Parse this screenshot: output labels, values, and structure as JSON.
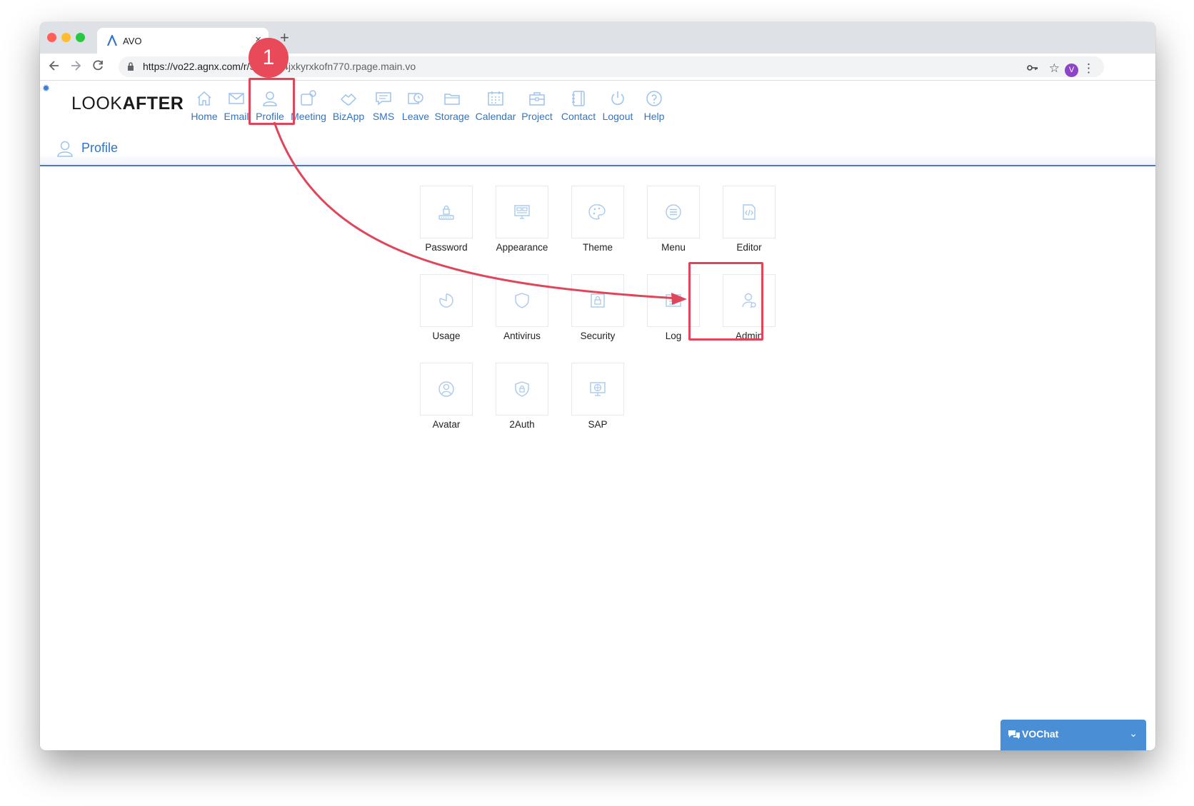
{
  "browser": {
    "tab_title": "AVO",
    "tab_close": "×",
    "new_tab": "+",
    "url_domain": "https://vo22.agnx.com/r/",
    "url_rest": "3976344jxkyrxkofn770.rpage.main.vo",
    "profile_initial": "V",
    "colors": {
      "close": "#ff5f57",
      "minimize": "#febc2e",
      "zoom": "#28c840"
    }
  },
  "app": {
    "brand_light": "LOOK",
    "brand_bold": "AFTER",
    "accent": "#2f74c8"
  },
  "nav": [
    {
      "label": "Home",
      "icon": "home-icon"
    },
    {
      "label": "Email",
      "icon": "envelope-icon"
    },
    {
      "label": "Profile",
      "icon": "user-icon"
    },
    {
      "label": "Meeting",
      "icon": "meeting-icon"
    },
    {
      "label": "BizApp",
      "icon": "handshake-icon"
    },
    {
      "label": "SMS",
      "icon": "message-icon"
    },
    {
      "label": "Leave",
      "icon": "calendar-clock-icon"
    },
    {
      "label": "Storage",
      "icon": "folder-icon"
    },
    {
      "label": "Calendar",
      "icon": "calendar-icon"
    },
    {
      "label": "Project",
      "icon": "briefcase-icon"
    },
    {
      "label": "Contact",
      "icon": "address-book-icon"
    },
    {
      "label": "Logout",
      "icon": "power-icon"
    },
    {
      "label": "Help",
      "icon": "help-icon"
    }
  ],
  "page": {
    "title": "Profile"
  },
  "tiles": [
    {
      "label": "Password",
      "icon": "password-lock-icon"
    },
    {
      "label": "Appearance",
      "icon": "appearance-icon"
    },
    {
      "label": "Theme",
      "icon": "palette-icon"
    },
    {
      "label": "Menu",
      "icon": "menu-list-icon"
    },
    {
      "label": "Editor",
      "icon": "code-file-icon"
    },
    {
      "label": "Usage",
      "icon": "pie-chart-icon"
    },
    {
      "label": "Antivirus",
      "icon": "shield-icon"
    },
    {
      "label": "Security",
      "icon": "security-lock-icon"
    },
    {
      "label": "Log",
      "icon": "log-icon"
    },
    {
      "label": "Admin",
      "icon": "admin-user-icon"
    },
    {
      "label": "Avatar",
      "icon": "avatar-circle-icon"
    },
    {
      "label": "2Auth",
      "icon": "shield-lock-icon"
    },
    {
      "label": "SAP",
      "icon": "monitor-globe-icon"
    }
  ],
  "annotation": {
    "step": "1",
    "color": "#e04559"
  },
  "chat": {
    "title": "VOChat",
    "color": "#4a8fd6"
  }
}
